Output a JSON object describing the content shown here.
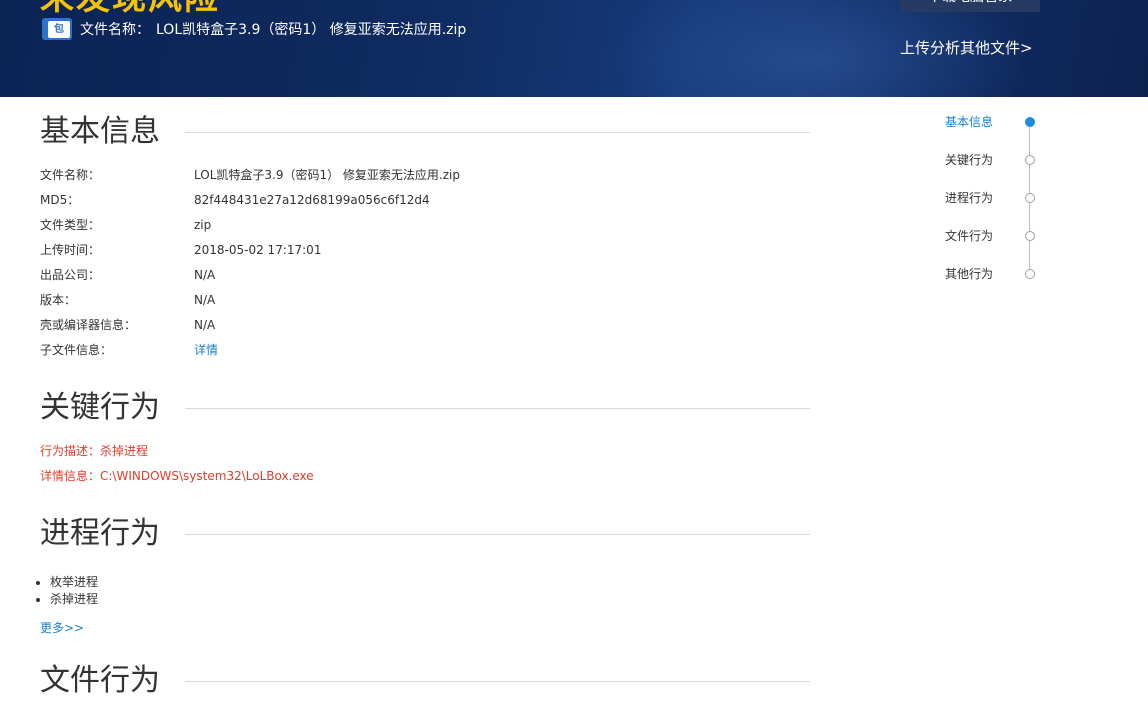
{
  "header": {
    "status_title": "未发现风险",
    "file_label": "文件名称：",
    "file_name": "LOL凯特盒子3.9（密码1） 修复亚索无法应用.zip",
    "download_button": "下载电脑管家",
    "upload_link": "上传分析其他文件>",
    "zip_icon_text": "包"
  },
  "sections": {
    "basic": {
      "title": "基本信息",
      "rows": [
        {
          "label": "文件名称：",
          "value": "LOL凯特盒子3.9（密码1） 修复亚索无法应用.zip"
        },
        {
          "label": "MD5：",
          "value": "82f448431e27a12d68199a056c6f12d4"
        },
        {
          "label": "文件类型：",
          "value": "zip"
        },
        {
          "label": "上传时间：",
          "value": "2018-05-02 17:17:01"
        },
        {
          "label": "出品公司：",
          "value": "N/A"
        },
        {
          "label": "版本：",
          "value": "N/A"
        },
        {
          "label": "壳或编译器信息：",
          "value": "N/A"
        },
        {
          "label": "子文件信息：",
          "value": "详情"
        }
      ]
    },
    "key_behavior": {
      "title": "关键行为",
      "description": "行为描述：杀掉进程",
      "detail": "详情信息：C:\\WINDOWS\\system32\\LoLBox.exe"
    },
    "process_behavior": {
      "title": "进程行为",
      "items": [
        "枚举进程",
        "杀掉进程"
      ],
      "more": "更多>>"
    },
    "file_behavior": {
      "title": "文件行为"
    }
  },
  "nav": {
    "items": [
      "基本信息",
      "关键行为",
      "进程行为",
      "文件行为",
      "其他行为"
    ],
    "active_index": 0
  },
  "colors": {
    "header_bg": "#0f2a5e",
    "status_title": "#f5c400",
    "link": "#1a7fd0",
    "alert": "#e03c2b"
  }
}
